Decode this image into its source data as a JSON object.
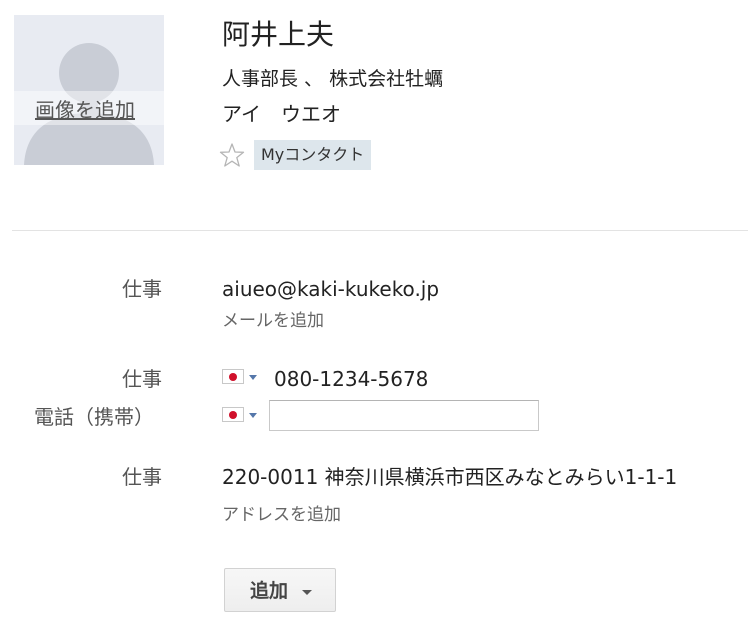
{
  "contact": {
    "photo": {
      "add_photo_label": "画像を追加"
    },
    "name": "阿井上夫",
    "job_line": "人事部長 、 株式会社牡蠣",
    "phonetic_name": "アイ　ウエオ",
    "group_tag": "Myコンタクト"
  },
  "details": {
    "email": {
      "label": "仕事",
      "value": "aiueo@kaki-kukeko.jp",
      "add_label": "メールを追加"
    },
    "phones": [
      {
        "label": "仕事",
        "country_flag": "japan-flag",
        "value": "080-1234-5678"
      },
      {
        "label": "電話（携帯）",
        "country_flag": "japan-flag",
        "value": ""
      }
    ],
    "address": {
      "label": "仕事",
      "value": "220-0011 神奈川県横浜市西区みなとみらい1-1-1",
      "add_label": "アドレスを追加"
    }
  },
  "actions": {
    "add_button_label": "追加"
  },
  "colors": {
    "tag_background": "#dde6ec",
    "flag_red": "#d0102b",
    "divider": "#e3e3e3"
  }
}
